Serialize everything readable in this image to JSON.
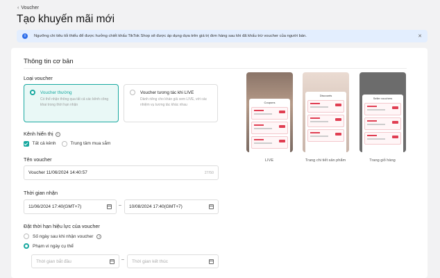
{
  "header": {
    "back_label": "Voucher",
    "page_title": "Tạo khuyến mãi mới"
  },
  "banner": {
    "text": "Ngưỡng chi tiêu tối thiểu để được hưởng chiết khấu TikTok Shop sẽ được áp dụng dựa trên giá trị đơn hàng sau khi đã khấu trừ voucher của người bán."
  },
  "basic_info": {
    "section_title": "Thông tin cơ bản",
    "voucher_type": {
      "label": "Loại voucher",
      "options": [
        {
          "name": "Voucher thường",
          "desc": "Có thể nhận thông qua tất cả các kênh công khai trong thời hạn nhận",
          "selected": true
        },
        {
          "name": "Voucher tương tác khi LIVE",
          "desc": "Dành riêng cho khán giả xem LIVE, với các nhiệm vụ tương tác khác nhau",
          "selected": false
        }
      ]
    },
    "display_channel": {
      "label": "Kênh hiển thị",
      "options": [
        {
          "name": "Tất cả kênh",
          "checked": true
        },
        {
          "name": "Trung tâm mua sắm",
          "checked": false
        }
      ]
    },
    "voucher_name": {
      "label": "Tên voucher",
      "value": "Voucher 11/06/2024 14:40:57",
      "counter": "27/50"
    },
    "claim_period": {
      "label": "Thời gian nhận",
      "start": "11/06/2024 17:40(GMT+7)",
      "end": "10/08/2024 17:40(GMT+7)",
      "separator": "–"
    },
    "validity": {
      "label": "Đặt thời hạn hiệu lực của voucher",
      "options": [
        {
          "name": "Số ngày sau khi nhận voucher",
          "selected": false
        },
        {
          "name": "Phạm vi ngày cụ thể",
          "selected": true
        }
      ],
      "start_placeholder": "Thời gian bắt đầu",
      "end_placeholder": "Thời gian kết thúc",
      "separator": "–"
    }
  },
  "previews": [
    {
      "caption": "LIVE",
      "sheet_title": "Coupons"
    },
    {
      "caption": "Trang chi tiết sản phẩm",
      "sheet_title": "Discounts"
    },
    {
      "caption": "Trang giỏ hàng",
      "sheet_title": "Seller vouchers"
    }
  ],
  "colors": {
    "accent": "#17a89f",
    "banner_bg": "#e3eefe",
    "info_icon": "#2f6fea",
    "voucher_red": "#e03e52"
  }
}
